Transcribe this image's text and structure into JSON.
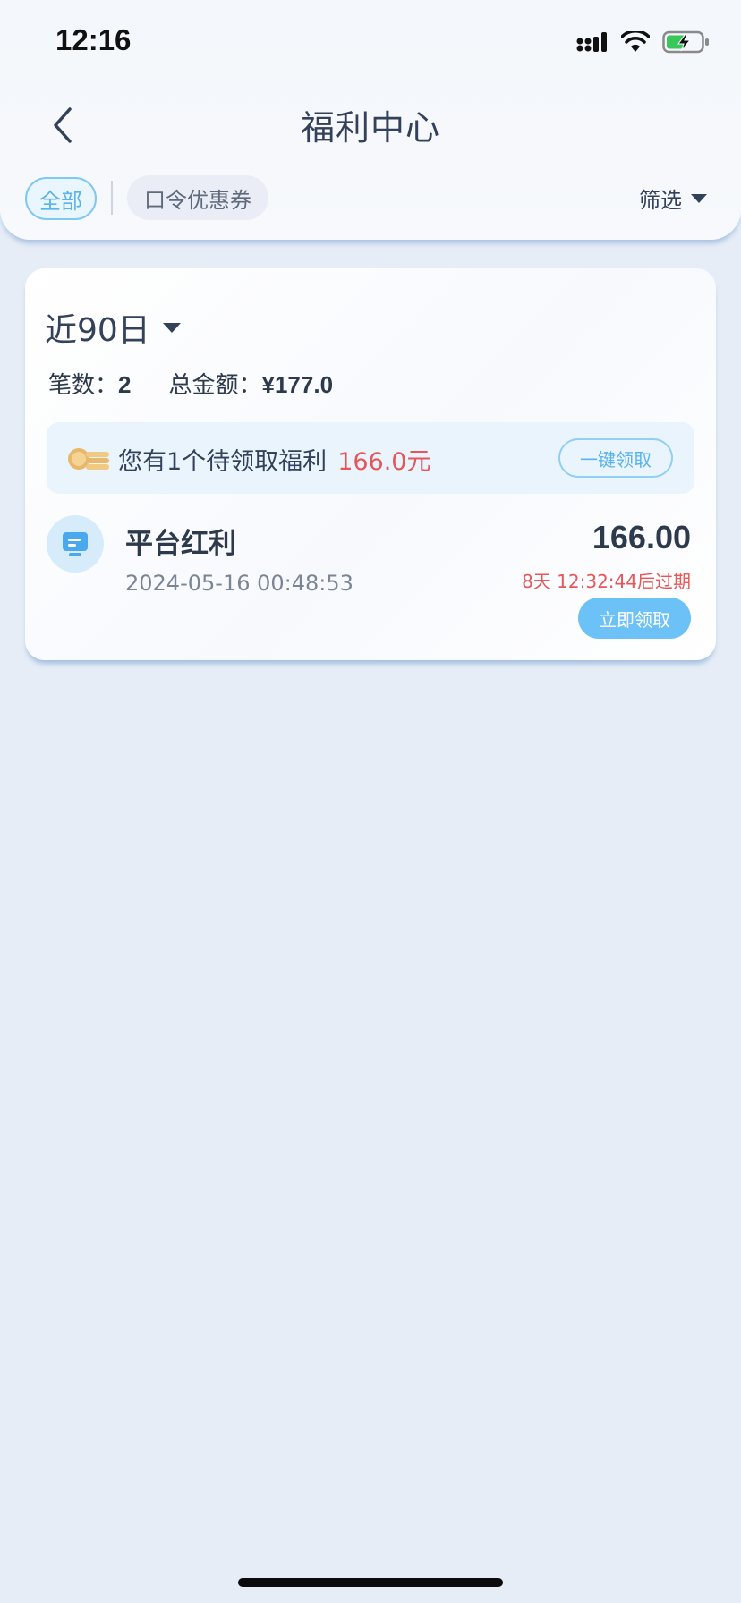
{
  "status_bar": {
    "time": "12:16"
  },
  "header": {
    "title": "福利中心",
    "tabs": [
      {
        "label": "全部",
        "active": true
      },
      {
        "label": "口令优惠券",
        "active": false
      }
    ],
    "filter_label": "筛选"
  },
  "summary": {
    "period": "近90日",
    "count_label": "笔数：",
    "count_value": "2",
    "total_label": "总金额：",
    "total_value": "¥177.0"
  },
  "banner": {
    "text": "您有1个待领取福利",
    "amount": "166.0元",
    "button_label": "一键领取"
  },
  "items": [
    {
      "name": "平台红利",
      "date": "2024-05-16 00:48:53",
      "amount": "166.00",
      "expiry": "8天 12:32:44后过期",
      "button_label": "立即领取",
      "icon": "monitor-icon"
    }
  ],
  "colors": {
    "accent": "#6cc1f6",
    "warning": "#e6575a",
    "background": "#e6edf7"
  }
}
